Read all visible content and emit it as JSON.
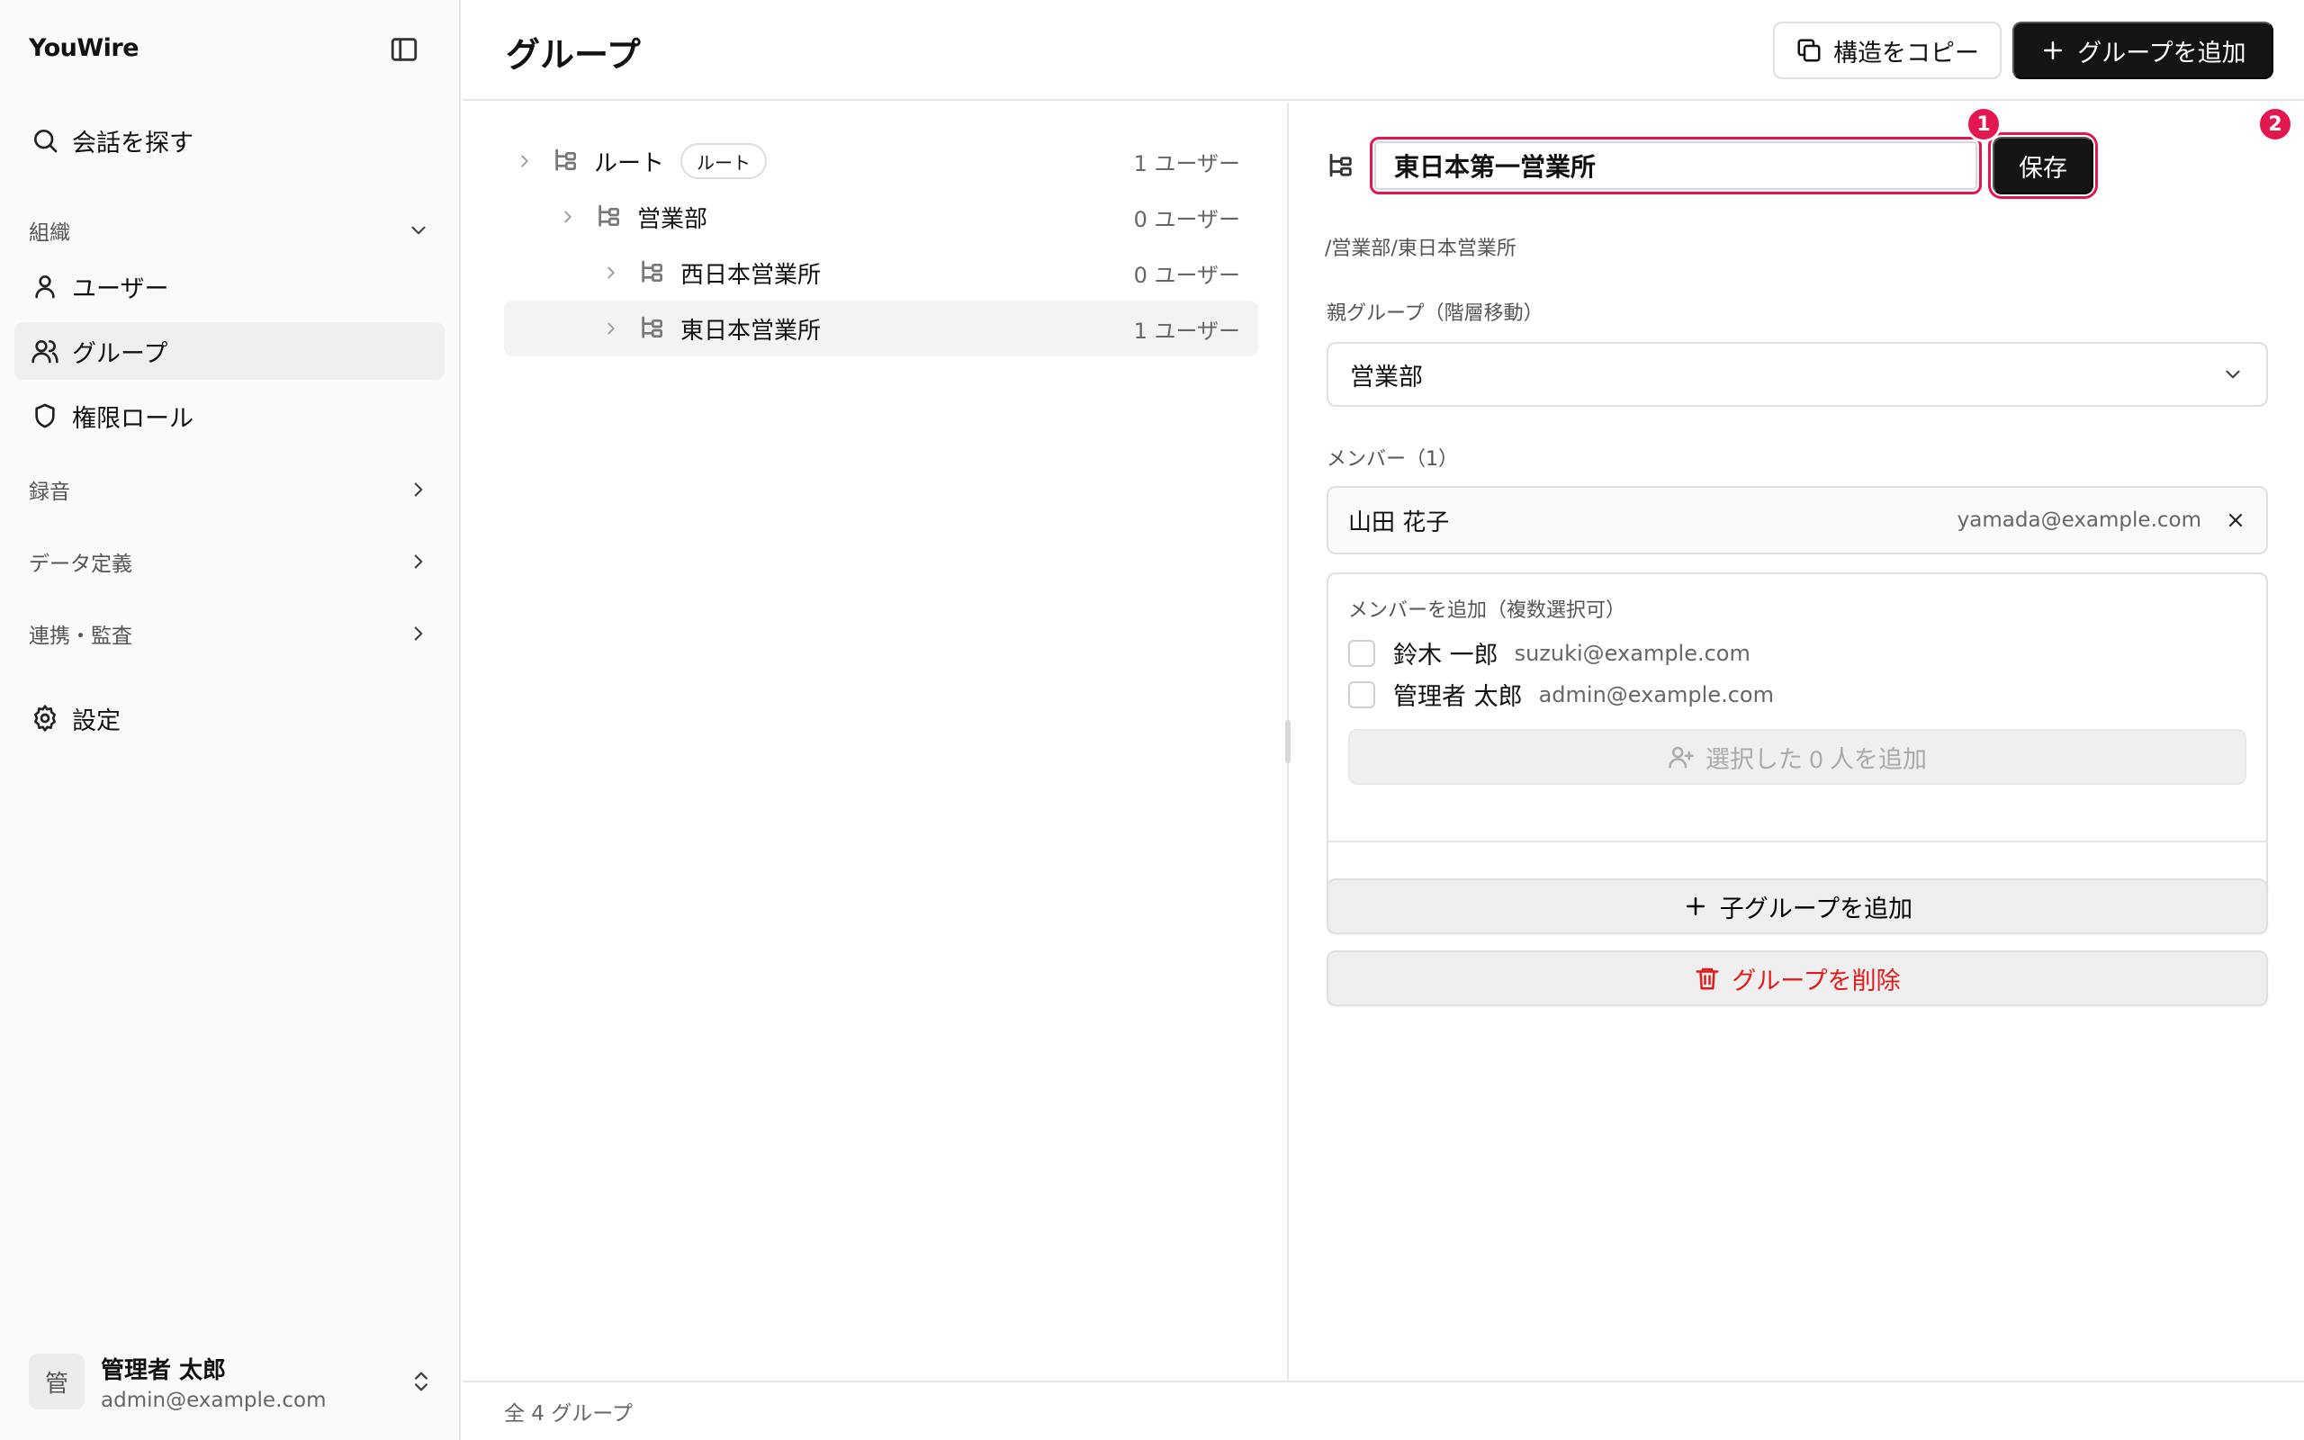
{
  "app": {
    "brand": "YouWire"
  },
  "sidebar": {
    "search_label": "会話を探す",
    "sections": {
      "org": "組織",
      "recording": "録音",
      "data_def": "データ定義",
      "integration": "連携・監査"
    },
    "items": {
      "users": "ユーザー",
      "groups": "グループ",
      "roles": "権限ロール",
      "settings": "設定"
    },
    "user": {
      "avatar": "管",
      "name": "管理者 太郎",
      "email": "admin@example.com"
    }
  },
  "header": {
    "title": "グループ",
    "copy_label": "構造をコピー",
    "add_label": "グループを追加"
  },
  "tree": {
    "rows": [
      {
        "label": "ルート",
        "badge": "ルート",
        "count": "1 ユーザー"
      },
      {
        "label": "営業部",
        "count": "0 ユーザー"
      },
      {
        "label": "西日本営業所",
        "count": "0 ユーザー"
      },
      {
        "label": "東日本営業所",
        "count": "1 ユーザー"
      }
    ]
  },
  "detail": {
    "name_value": "東日本第一営業所",
    "save_label": "保存",
    "marker_1": "1",
    "marker_2": "2",
    "path": "/営業部/東日本営業所",
    "parent_label": "親グループ（階層移動）",
    "parent_value": "営業部",
    "members_label": "メンバー（1）",
    "members": [
      {
        "name": "山田 花子",
        "email": "yamada@example.com"
      }
    ],
    "add_members_label": "メンバーを追加（複数選択可）",
    "candidates": [
      {
        "name": "鈴木 一郎",
        "email": "suzuki@example.com"
      },
      {
        "name": "管理者 太郎",
        "email": "admin@example.com"
      }
    ],
    "add_selected_label": "選択した 0 人を追加",
    "add_child_label": "子グループを追加",
    "delete_label": "グループを削除"
  },
  "footer": {
    "summary": "全 4 グループ"
  },
  "colors": {
    "accent": "#e2174f",
    "danger": "#e01b1b",
    "primary": "#141414"
  }
}
